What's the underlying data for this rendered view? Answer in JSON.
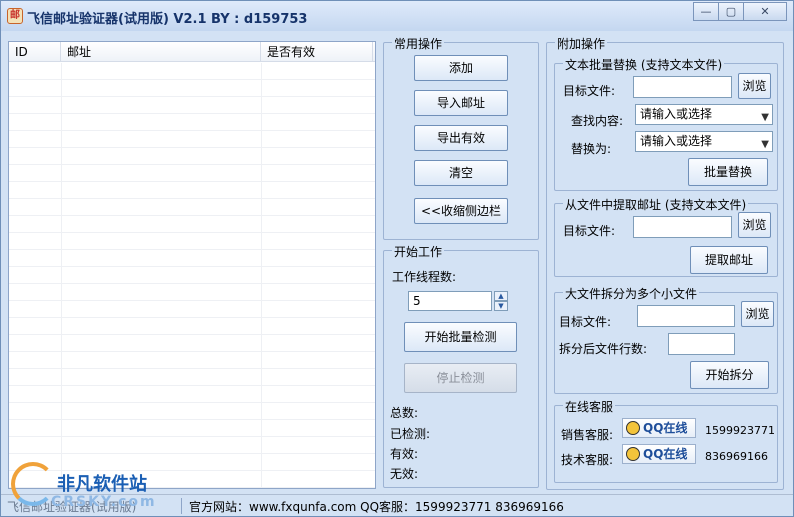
{
  "window": {
    "title": "飞信邮址验证器(试用版)  V2.1   BY : d159753",
    "app_icon_glyph": "邮",
    "minimize": "—",
    "maximize": "▢",
    "close": "✕"
  },
  "list": {
    "columns": [
      "ID",
      "邮址",
      "是否有效"
    ]
  },
  "common_ops": {
    "label": "常用操作",
    "add": "添加",
    "import": "导入邮址",
    "export": "导出有效",
    "clear": "清空",
    "collapse": "<<收缩侧边栏"
  },
  "start_work": {
    "label": "开始工作",
    "threads_label": "工作线程数:",
    "threads_value": "5",
    "start_button": "开始批量检测",
    "stop_button": "停止检测",
    "total_label": "总数:",
    "checked_label": "已检测:",
    "valid_label": "有效:",
    "invalid_label": "无效:"
  },
  "extra_ops": {
    "label": "附加操作",
    "replace": {
      "label": "文本批量替换 (支持文本文件)",
      "target_label": "目标文件:",
      "browse": "浏览",
      "find_label": "查找内容:",
      "find_placeholder": "请输入或选择",
      "replace_label": "替换为:",
      "replace_placeholder": "请输入或选择",
      "button": "批量替换"
    },
    "extract": {
      "label": "从文件中提取邮址 (支持文本文件)",
      "target_label": "目标文件:",
      "browse": "浏览",
      "button": "提取邮址"
    },
    "split": {
      "label": "大文件拆分为多个小文件",
      "target_label": "目标文件:",
      "browse": "浏览",
      "lines_label": "拆分后文件行数:",
      "button": "开始拆分"
    },
    "support": {
      "label": "在线客服",
      "sales_label": "销售客服:",
      "sales_qq_btn": "QQ在线",
      "sales_number": "1599923771",
      "tech_label": "技术客服:",
      "tech_qq_btn": "QQ在线",
      "tech_number": "836969166"
    }
  },
  "status": {
    "left_text": "飞信邮址验证器(试用版)",
    "website": "官方网站：www.fxqunfa.com QQ客服：1599923771 836969166"
  },
  "watermark": {
    "title": "非凡软件站",
    "sub": "CRSKY.com"
  }
}
